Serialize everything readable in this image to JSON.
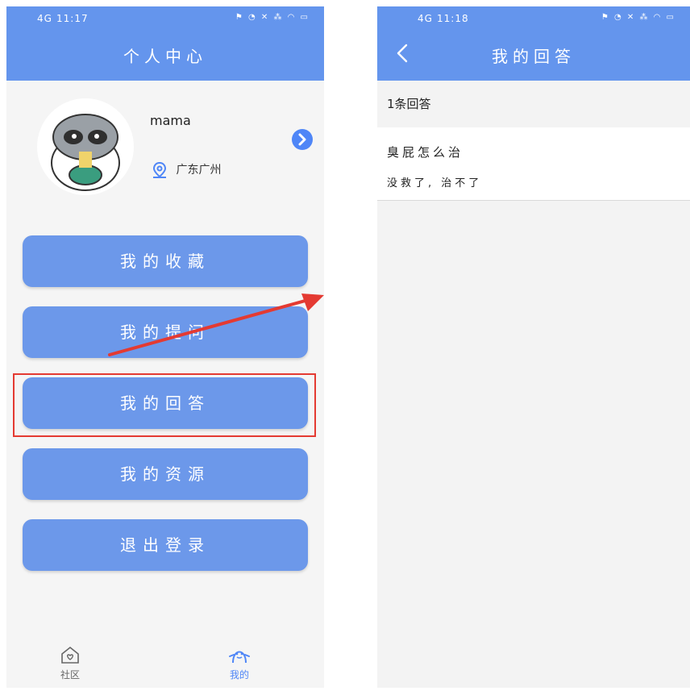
{
  "left": {
    "status": {
      "time": "11:17",
      "network": "4G"
    },
    "title": "个人中心",
    "profile": {
      "username": "mama",
      "location": "广东广州"
    },
    "menu": [
      "我的收藏",
      "我的提问",
      "我的回答",
      "我的资源",
      "退出登录"
    ],
    "tabs": [
      {
        "label": "社区",
        "icon": "home-heart-icon"
      },
      {
        "label": "我的",
        "icon": "person-icon"
      }
    ]
  },
  "right": {
    "status": {
      "time": "11:18",
      "network": "4G"
    },
    "title": "我的回答",
    "count_label": "1条回答",
    "answers": [
      {
        "question": "臭屁怎么治",
        "answer": "没救了, 治不了"
      }
    ]
  },
  "colors": {
    "primary": "#6495ed",
    "button": "#6c98ea",
    "highlight": "#e43a32",
    "arrow": "#e43a32"
  }
}
